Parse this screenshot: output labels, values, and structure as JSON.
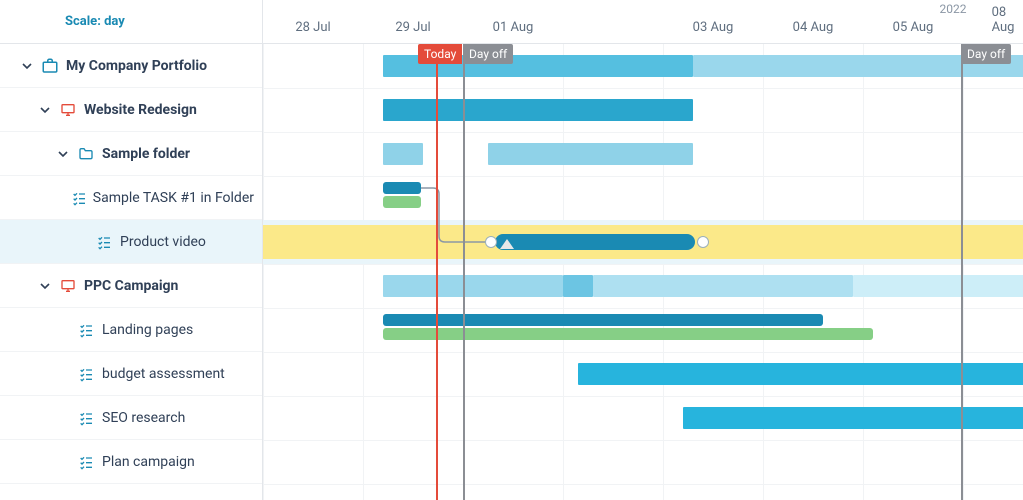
{
  "scale_label": "Scale: day",
  "year_label": "2022",
  "timeline": {
    "ticks": [
      "28 Jul",
      "29 Jul",
      "01 Aug",
      "03 Aug",
      "04 Aug",
      "05 Aug",
      "08 Aug"
    ]
  },
  "markers": {
    "today_label": "Today",
    "dayoff_label": "Day off"
  },
  "tree": {
    "portfolio": "My Company Portfolio",
    "project1": "Website Redesign",
    "folder1": "Sample folder",
    "task1": "Sample TASK #1 in Folder",
    "task2": "Product video",
    "project2": "PPC Campaign",
    "task3": "Landing pages",
    "task4": "budget assessment",
    "task5": "SEO research",
    "task6": "Plan campaign"
  },
  "chart_data": {
    "type": "gantt",
    "unit": "day",
    "visible_range_start": "2022-07-28",
    "items": [
      {
        "id": "portfolio",
        "kind": "summary",
        "start": "2022-07-29",
        "segments": [
          {
            "from": "2022-07-29",
            "to": "2022-08-03",
            "shade": "normal"
          },
          {
            "from": "2022-08-03",
            "to": "2022-08-08+",
            "shade": "light"
          }
        ]
      },
      {
        "id": "project1",
        "kind": "summary",
        "start": "2022-07-29",
        "end": "2022-08-03",
        "color": "#2aa6cd"
      },
      {
        "id": "folder1",
        "kind": "summary",
        "segments": [
          {
            "from": "2022-07-29",
            "to": "2022-07-30",
            "color": "#8fd2e8"
          },
          {
            "from": "2022-08-01",
            "to": "2022-08-03",
            "color": "#8fd2e8"
          }
        ]
      },
      {
        "id": "task1",
        "kind": "task",
        "bars": [
          {
            "from": "2022-07-29",
            "to": "2022-07-30",
            "color": "#2aa6cd"
          },
          {
            "from": "2022-07-29",
            "to": "2022-07-30",
            "color": "#86cf86",
            "offset": "below"
          }
        ]
      },
      {
        "id": "task2",
        "kind": "task",
        "from": "2022-08-01",
        "to": "2022-08-03",
        "color": "#1a8ab3",
        "track": "highlight-yellow",
        "handles": true,
        "depends_on": "task1"
      },
      {
        "id": "project2",
        "kind": "summary",
        "start": "2022-07-29",
        "segments": [
          {
            "from": "2022-07-29",
            "to": "2022-08-01",
            "shade": "light"
          },
          {
            "from": "2022-08-01",
            "to": "2022-08-02",
            "shade": "normal"
          },
          {
            "from": "2022-08-02",
            "to": "2022-08-05",
            "shade": "light"
          },
          {
            "from": "2022-08-05",
            "to": "2022-08-08+",
            "shade": "lighter"
          }
        ]
      },
      {
        "id": "task3",
        "kind": "task",
        "bars": [
          {
            "from": "2022-07-29",
            "to": "2022-08-04",
            "color": "#1a8ab3"
          },
          {
            "from": "2022-07-29",
            "to": "2022-08-05",
            "color": "#86cf86",
            "offset": "below"
          }
        ]
      },
      {
        "id": "task4",
        "kind": "task",
        "from": "2022-08-02",
        "to": "2022-08-08+",
        "color": "#27b4dd"
      },
      {
        "id": "task5",
        "kind": "task",
        "from": "2022-08-03",
        "to": "2022-08-08+",
        "color": "#27b4dd"
      }
    ]
  }
}
